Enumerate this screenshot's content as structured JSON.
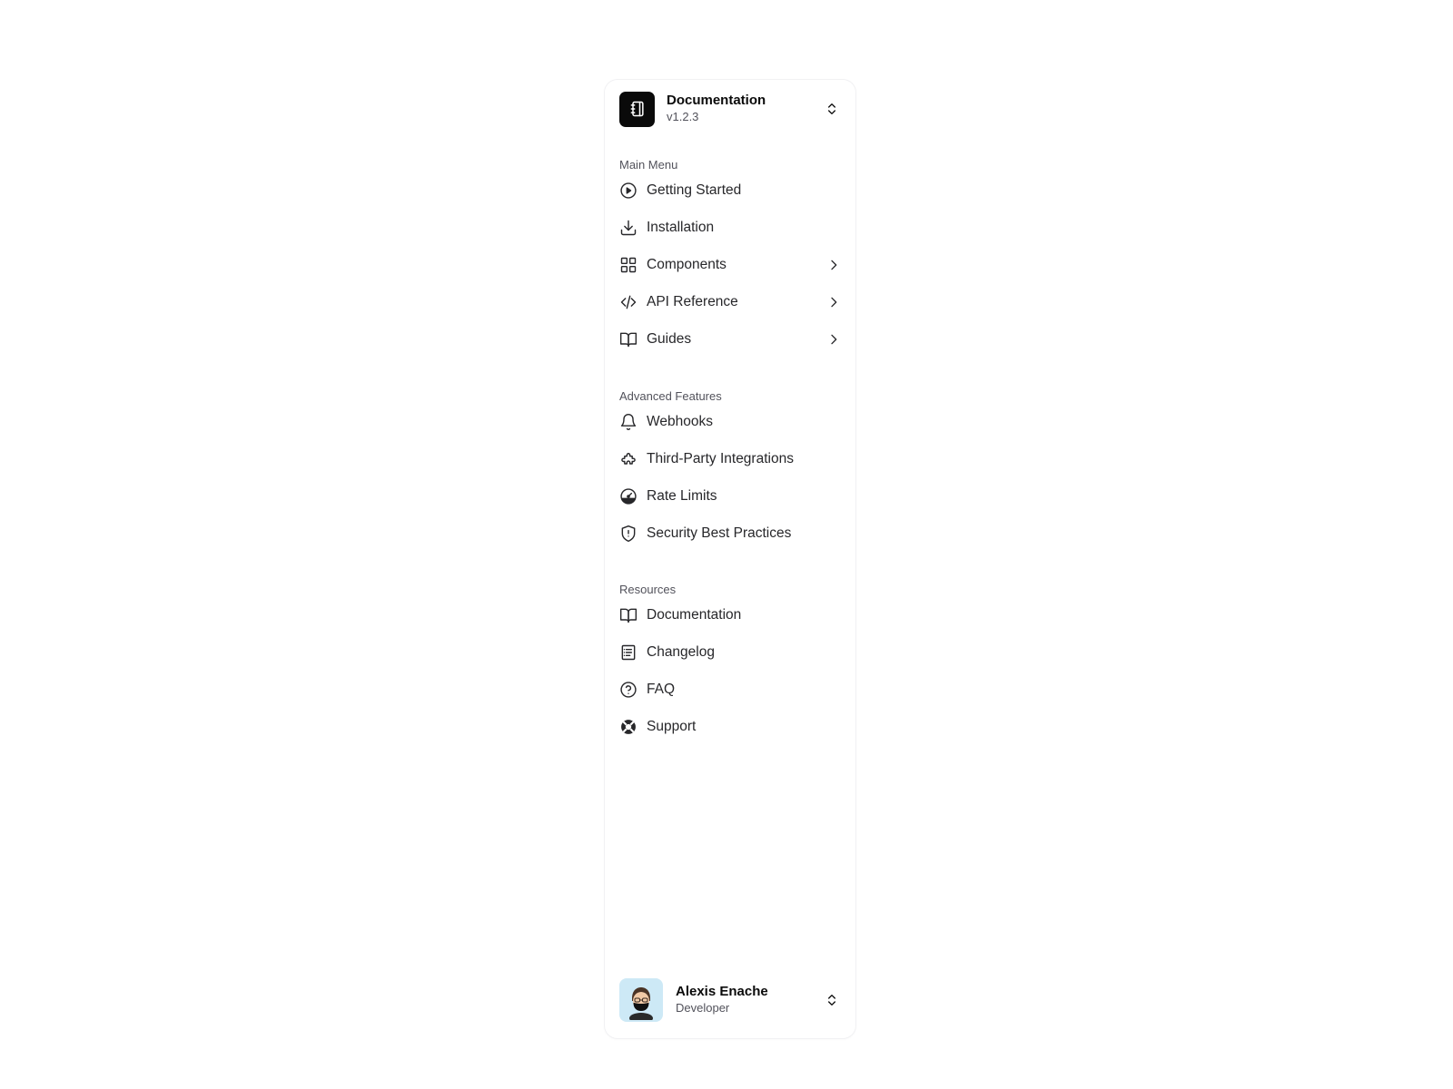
{
  "header": {
    "title": "Documentation",
    "version": "v1.2.3",
    "logo_icon": "notebook-icon",
    "switcher_icon": "chevrons-up-down-icon"
  },
  "sections": [
    {
      "label": "Main Menu",
      "items": [
        {
          "label": "Getting Started",
          "icon": "play-circle-icon",
          "has_submenu": false
        },
        {
          "label": "Installation",
          "icon": "download-icon",
          "has_submenu": false
        },
        {
          "label": "Components",
          "icon": "layout-grid-icon",
          "has_submenu": true
        },
        {
          "label": "API Reference",
          "icon": "code-icon",
          "has_submenu": true
        },
        {
          "label": "Guides",
          "icon": "book-open-icon",
          "has_submenu": true
        }
      ]
    },
    {
      "label": "Advanced Features",
      "items": [
        {
          "label": "Webhooks",
          "icon": "bell-icon",
          "has_submenu": false
        },
        {
          "label": "Third-Party Integrations",
          "icon": "puzzle-icon",
          "has_submenu": false
        },
        {
          "label": "Rate Limits",
          "icon": "gauge-icon",
          "has_submenu": false
        },
        {
          "label": "Security Best Practices",
          "icon": "shield-alert-icon",
          "has_submenu": false
        }
      ]
    },
    {
      "label": "Resources",
      "items": [
        {
          "label": "Documentation",
          "icon": "book-open-icon",
          "has_submenu": false
        },
        {
          "label": "Changelog",
          "icon": "file-text-icon",
          "has_submenu": false
        },
        {
          "label": "FAQ",
          "icon": "help-circle-icon",
          "has_submenu": false
        },
        {
          "label": "Support",
          "icon": "life-buoy-icon",
          "has_submenu": false
        }
      ]
    }
  ],
  "user": {
    "name": "Alexis Enache",
    "role": "Developer",
    "avatar_icon": "avatar"
  },
  "colors": {
    "text": "#27272a",
    "muted": "#52525b",
    "logo_bg": "#0a0a0a",
    "avatar_bg": "#cde9f6"
  }
}
